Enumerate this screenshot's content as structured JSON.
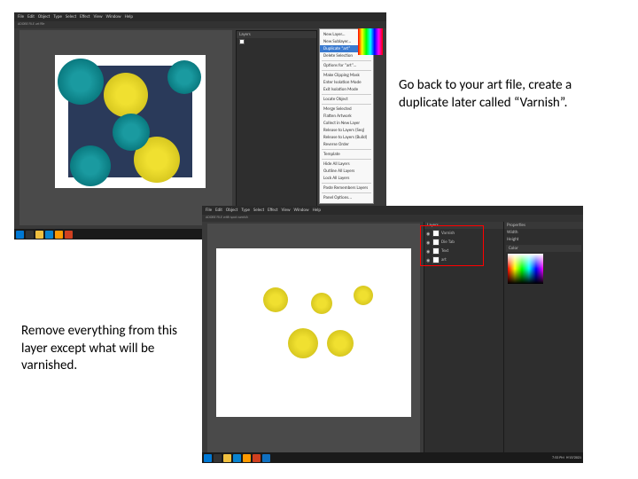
{
  "annotations": {
    "top_right": "Go back to your art file, create a duplicate later called “Varnish”.",
    "bottom_left": "Remove everything from this layer except what will be varnished."
  },
  "app": {
    "menu": [
      "File",
      "Edit",
      "Object",
      "Type",
      "Select",
      "Effect",
      "View",
      "Window",
      "Help"
    ]
  },
  "screenshot1": {
    "title": "ADOBE FILE art file",
    "dropdown": {
      "items": [
        "New Layer...",
        "New Sublayer...",
        "Duplicate “art”",
        "Delete Selection",
        "Options for “art”...",
        "Make Clipping Mask",
        "Enter Isolation Mode",
        "Exit Isolation Mode",
        "Locate Object",
        "Merge Selected",
        "Flatten Artwork",
        "Collect in New Layer",
        "Release to Layers (Seq)",
        "Release to Layers (Build)",
        "Reverse Order",
        "Template",
        "Hide All Layers",
        "Outline All Layers",
        "Lock All Layers",
        "Paste Remembers Layers",
        "Panel Options..."
      ],
      "highlighted": "Duplicate “art”"
    },
    "panel_tab": "Layers"
  },
  "screenshot2": {
    "title": "ADOBE FILE with spot varnish",
    "layers_panel": {
      "tab": "Layers",
      "layers": [
        {
          "name": "Varnish",
          "visible": true
        },
        {
          "name": "Die Tab",
          "visible": true
        },
        {
          "name": "Text",
          "visible": true
        },
        {
          "name": "art",
          "visible": true
        }
      ]
    },
    "properties_panel": {
      "tab": "Properties",
      "rows": [
        "Width",
        "Height"
      ]
    },
    "brush_tab": "Color"
  },
  "taskbar": {
    "time": "7:53 PM",
    "date": "9/15/2021"
  }
}
